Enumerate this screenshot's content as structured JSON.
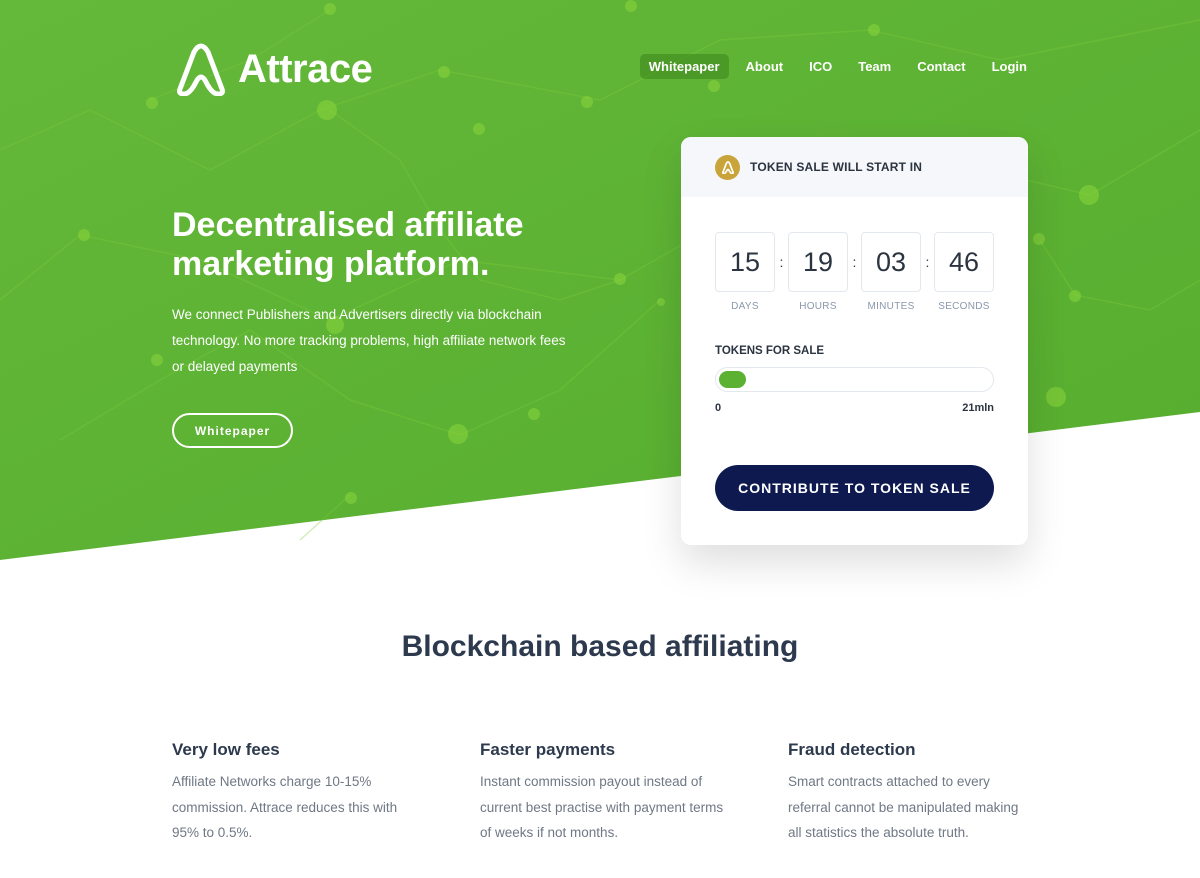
{
  "colors": {
    "hero_green": "#5cb133",
    "navy_button": "#0e1a4f",
    "gold_badge": "#c9a43a"
  },
  "logo": {
    "icon": "attrace-logo-icon",
    "text": "Attrace"
  },
  "nav": {
    "items": [
      {
        "label": "Whitepaper",
        "active": true
      },
      {
        "label": "About"
      },
      {
        "label": "ICO"
      },
      {
        "label": "Team"
      },
      {
        "label": "Contact"
      },
      {
        "label": "Login"
      }
    ]
  },
  "hero": {
    "headline": "Decentralised affiliate marketing platform.",
    "subtext": "We connect Publishers and Advertisers directly via blockchain technology. No more tracking problems, high affiliate network fees or delayed payments",
    "button_label": "Whitepaper"
  },
  "sale_card": {
    "badge_icon": "attrace-logo-icon",
    "title": "TOKEN SALE WILL START IN",
    "countdown": [
      {
        "value": "15",
        "label": "DAYS"
      },
      {
        "value": "19",
        "label": "HOURS"
      },
      {
        "value": "03",
        "label": "MINUTES"
      },
      {
        "value": "46",
        "label": "SECONDS"
      }
    ],
    "separator": ":",
    "tokens_title": "TOKENS FOR SALE",
    "progress_fraction": 0.1,
    "range_min": "0",
    "range_max": "21mln",
    "cta_label": "CONTRIBUTE TO TOKEN SALE"
  },
  "section": {
    "title": "Blockchain based affiliating"
  },
  "features": [
    {
      "title": "Very low fees",
      "text": "Affiliate Networks charge 10-15% commission. Attrace reduces this with 95% to 0.5%."
    },
    {
      "title": "Faster payments",
      "text": "Instant commission payout instead of current best practise with payment terms of weeks if not months."
    },
    {
      "title": "Fraud detection",
      "text": "Smart contracts attached to every referral cannot be manipulated making all statistics the absolute truth."
    }
  ]
}
